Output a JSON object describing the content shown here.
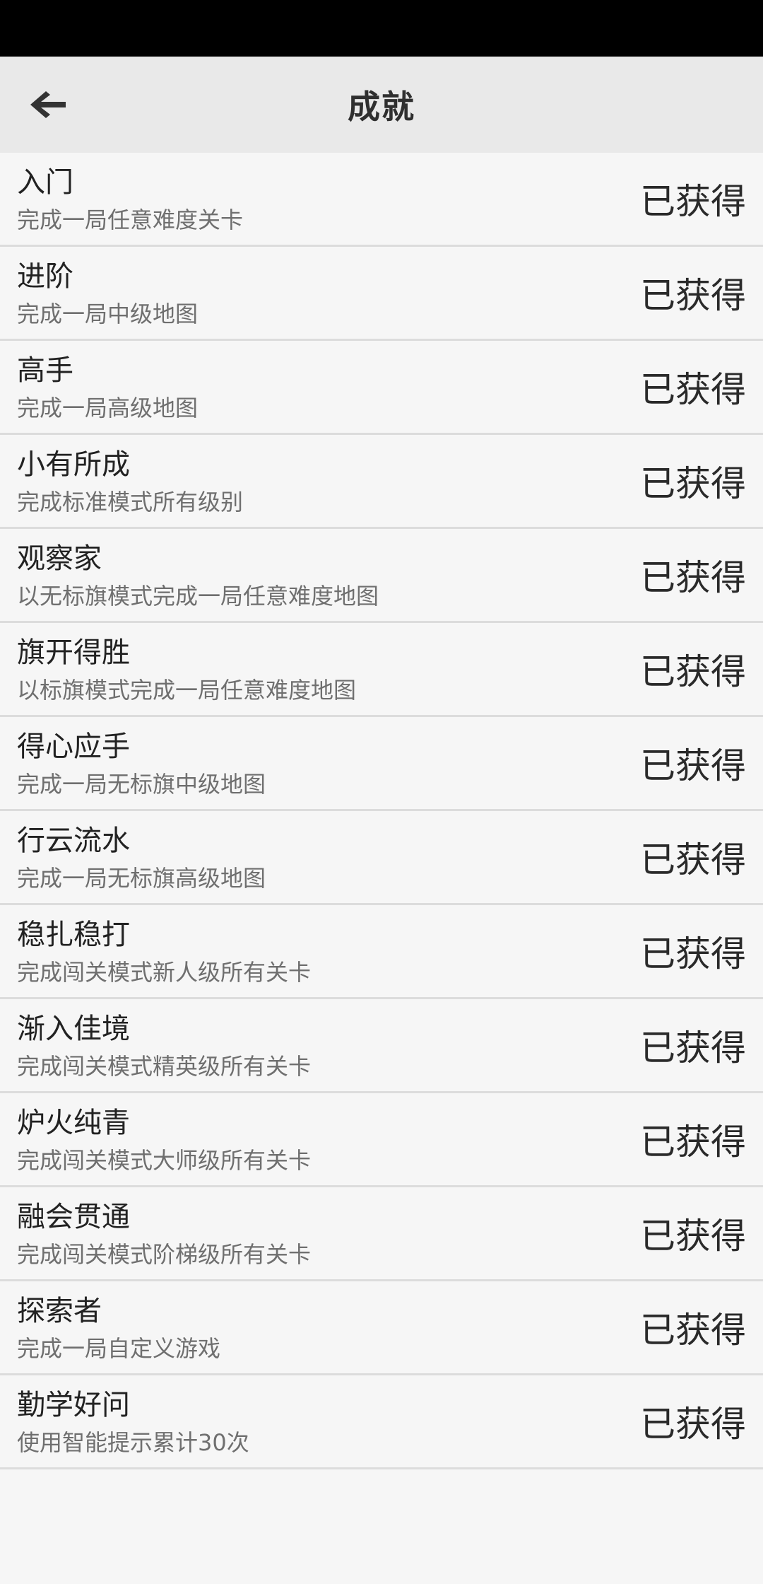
{
  "header": {
    "title": "成就",
    "back_icon": "arrow-left-icon"
  },
  "colors": {
    "status_bar": "#000000",
    "app_bar": "#e9e9e9",
    "background": "#f6f6f6",
    "divider": "#dcdcdc"
  },
  "achievements": [
    {
      "title": "入门",
      "desc": "完成一局任意难度关卡",
      "status": "已获得"
    },
    {
      "title": "进阶",
      "desc": "完成一局中级地图",
      "status": "已获得"
    },
    {
      "title": "高手",
      "desc": "完成一局高级地图",
      "status": "已获得"
    },
    {
      "title": "小有所成",
      "desc": "完成标准模式所有级别",
      "status": "已获得"
    },
    {
      "title": "观察家",
      "desc": "以无标旗模式完成一局任意难度地图",
      "status": "已获得"
    },
    {
      "title": "旗开得胜",
      "desc": "以标旗模式完成一局任意难度地图",
      "status": "已获得"
    },
    {
      "title": "得心应手",
      "desc": "完成一局无标旗中级地图",
      "status": "已获得"
    },
    {
      "title": "行云流水",
      "desc": "完成一局无标旗高级地图",
      "status": "已获得"
    },
    {
      "title": "稳扎稳打",
      "desc": "完成闯关模式新人级所有关卡",
      "status": "已获得"
    },
    {
      "title": "渐入佳境",
      "desc": "完成闯关模式精英级所有关卡",
      "status": "已获得"
    },
    {
      "title": "炉火纯青",
      "desc": "完成闯关模式大师级所有关卡",
      "status": "已获得"
    },
    {
      "title": "融会贯通",
      "desc": "完成闯关模式阶梯级所有关卡",
      "status": "已获得"
    },
    {
      "title": "探索者",
      "desc": "完成一局自定义游戏",
      "status": "已获得"
    },
    {
      "title": "勤学好问",
      "desc": "使用智能提示累计30次",
      "status": "已获得"
    }
  ]
}
